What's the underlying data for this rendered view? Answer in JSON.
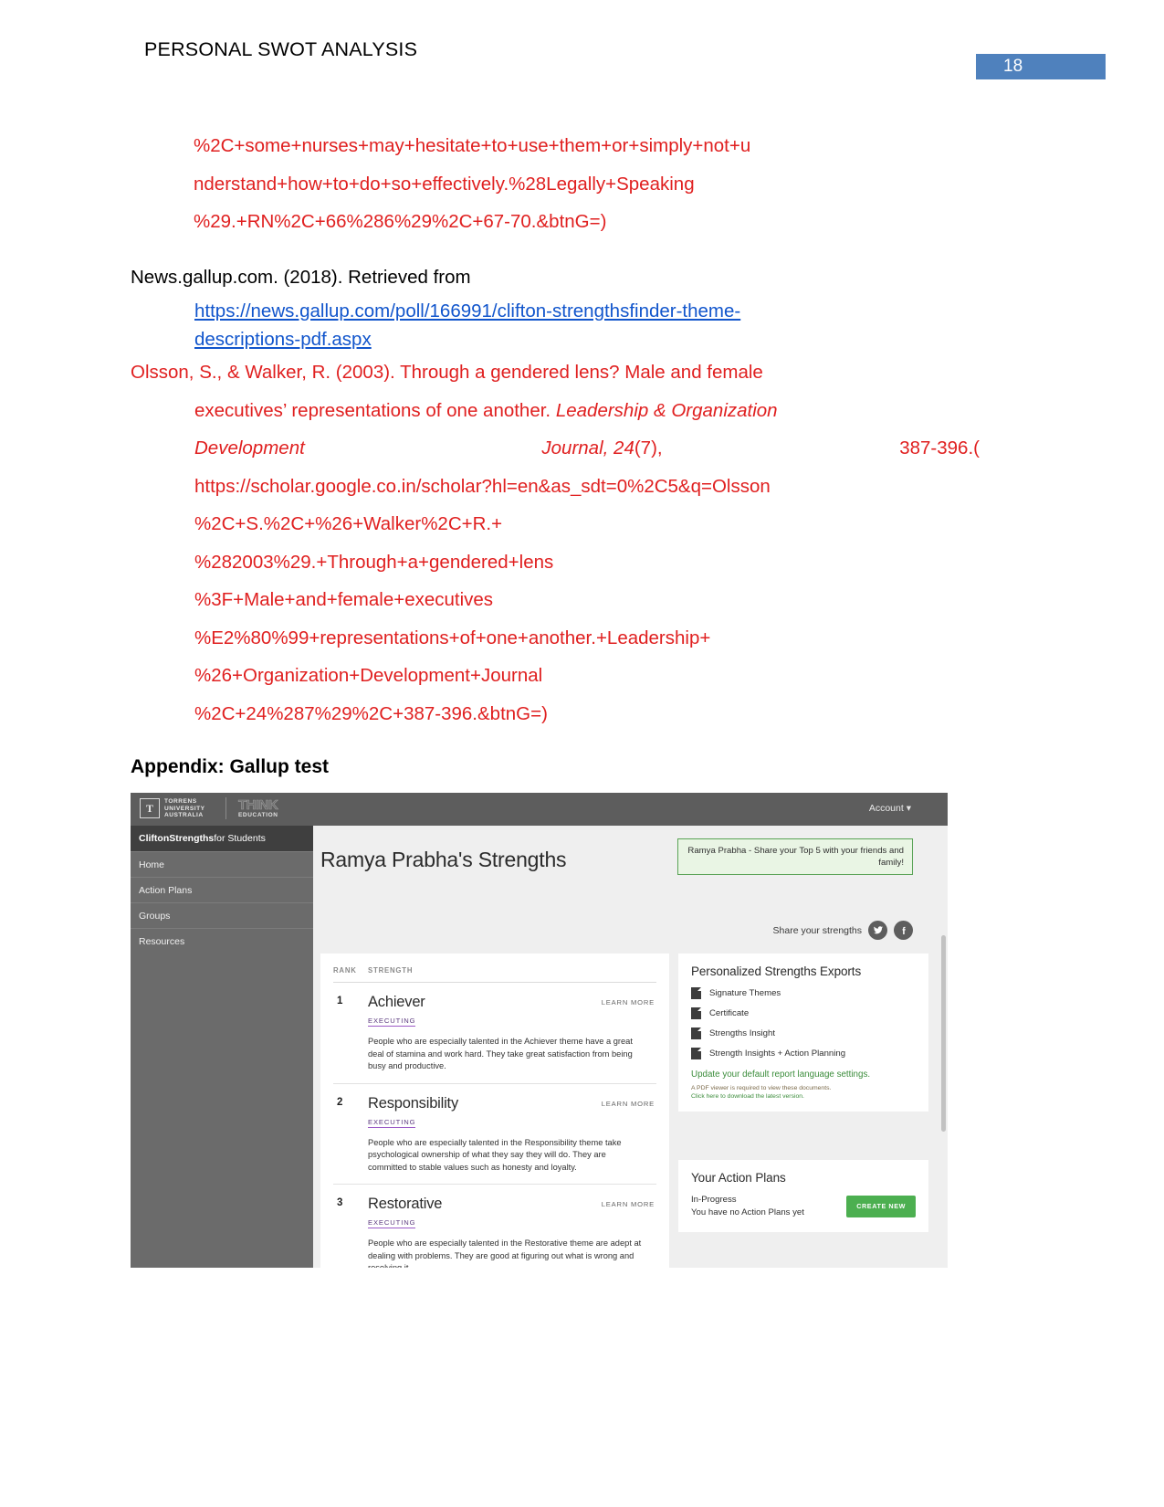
{
  "header": {
    "title": "PERSONAL SWOT ANALYSIS",
    "page_number": "18",
    "accent_color": "#4f81bd"
  },
  "references": {
    "continuation": {
      "color": "#e02020",
      "lines": [
        "%2C+some+nurses+may+hesitate+to+use+them+or+simply+not+u",
        "nderstand+how+to+do+so+effectively.%28Legally+Speaking",
        "%29.+RN%2C+66%286%29%2C+67-70.&btnG=)"
      ]
    },
    "gallup": {
      "text": "News.gallup.com. (2018). Retrieved from",
      "link_line1": "https://news.gallup.com/poll/166991/clifton-strengthsfinder-theme-",
      "link_line2": "descriptions-pdf.aspx",
      "link_color": "#1155cc"
    },
    "olsson": {
      "color": "#e02020",
      "line1": "Olsson, S., & Walker, R. (2003). Through a gendered lens? Male and female",
      "line2_plain": "executives’ representations of one another.",
      "line2_italic": "Leadership & Organization",
      "line3_left_italic": "Development",
      "line3_mid_italic": "Journal",
      "line3_mid_rest": ", 24",
      "line3_issue": "(7),",
      "line3_right": "387-396.(",
      "url_lines": [
        "https://scholar.google.co.in/scholar?hl=en&as_sdt=0%2C5&q=Olsson",
        "%2C+S.%2C+%26+Walker%2C+R.+",
        "%282003%29.+Through+a+gendered+lens",
        "%3F+Male+and+female+executives",
        "%E2%80%99+representations+of+one+another.+Leadership+",
        "%26+Organization+Development+Journal",
        "%2C+24%287%29%2C+387-396.&btnG=)"
      ]
    }
  },
  "appendix": {
    "heading": "Appendix: Gallup test"
  },
  "gallup_app": {
    "topbar": {
      "logo_torrens_mark": "T",
      "logo_torrens_line1": "TORRENS",
      "logo_torrens_line2": "UNIVERSITY",
      "logo_torrens_line3": "AUSTRALIA",
      "logo_think_big": "THINK",
      "logo_think_small": "EDUCATION",
      "account_label": "Account"
    },
    "sidebar": {
      "brand_bold": "CliftonStrengths",
      "brand_rest": " for Students",
      "items": [
        {
          "label": "Home"
        },
        {
          "label": "Action Plans"
        },
        {
          "label": "Groups"
        },
        {
          "label": "Resources"
        }
      ]
    },
    "main": {
      "title": "Ramya Prabha's Strengths",
      "notice_line1": "Ramya Prabha - Share your Top 5 with your friends and",
      "notice_line2": "family!",
      "share_label": "Share your strengths",
      "twitter_icon": "twitter-icon",
      "facebook_icon": "facebook-icon"
    },
    "strengths_panel": {
      "col_rank": "RANK",
      "col_strength": "STRENGTH",
      "learn_more": "LEARN MORE",
      "rows": [
        {
          "rank": "1",
          "name": "Achiever",
          "domain": "EXECUTING",
          "description": "People who are especially talented in the Achiever theme have a great deal of stamina and work hard. They take great satisfaction from being busy and productive."
        },
        {
          "rank": "2",
          "name": "Responsibility",
          "domain": "EXECUTING",
          "description": "People who are especially talented in the Responsibility theme take psychological ownership of what they say they will do. They are committed to stable values such as honesty and loyalty."
        },
        {
          "rank": "3",
          "name": "Restorative",
          "domain": "EXECUTING",
          "description": "People who are especially talented in the Restorative theme are adept at dealing with problems. They are good at figuring out what is wrong and resolving it."
        }
      ]
    },
    "exports_panel": {
      "title": "Personalized Strengths Exports",
      "items": [
        {
          "label": "Signature Themes"
        },
        {
          "label": "Certificate"
        },
        {
          "label": "Strengths Insight"
        },
        {
          "label": "Strength Insights + Action Planning"
        }
      ],
      "update_link": "Update your default report language settings.",
      "note_line1": "A PDF viewer is required to view these documents.",
      "note_line2": "Click here to download the latest version."
    },
    "action_plans_panel": {
      "title": "Your Action Plans",
      "status": "In-Progress",
      "empty_text": "You have no Action Plans yet",
      "create_button": "CREATE NEW",
      "create_button_color": "#4caf50"
    }
  }
}
